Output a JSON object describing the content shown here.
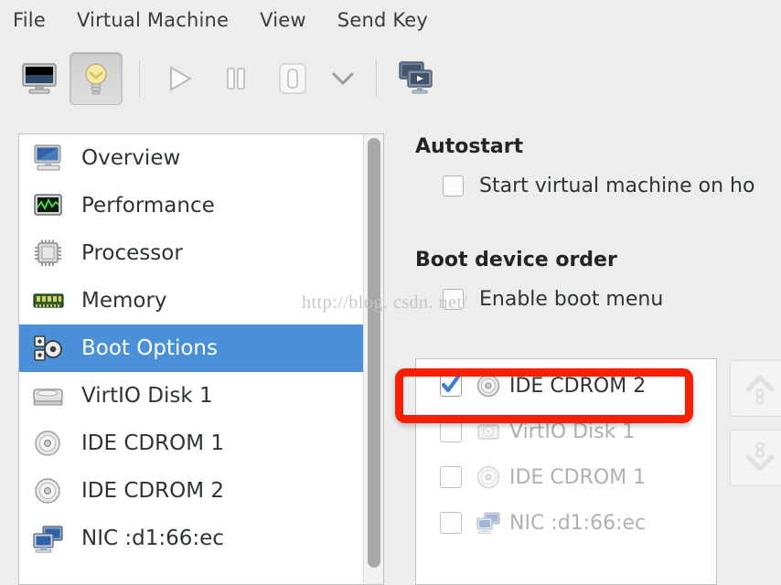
{
  "menubar": {
    "items": [
      {
        "label": "File",
        "name": "menu-file"
      },
      {
        "label": "Virtual Machine",
        "name": "menu-virtual-machine"
      },
      {
        "label": "View",
        "name": "menu-view"
      },
      {
        "label": "Send Key",
        "name": "menu-send-key"
      }
    ]
  },
  "toolbar": {
    "buttons": [
      {
        "icon": "monitor-console-icon",
        "pressed": false
      },
      {
        "icon": "lightbulb-details-icon",
        "pressed": true
      },
      {
        "icon": "play-run-icon",
        "pressed": false
      },
      {
        "icon": "pause-icon",
        "pressed": false
      },
      {
        "icon": "shutdown-icon",
        "pressed": false
      },
      {
        "icon": "chevron-down-icon",
        "pressed": false
      },
      {
        "icon": "snapshot-clone-icon",
        "pressed": false
      }
    ]
  },
  "hardware_list": {
    "items": [
      {
        "label": "Overview",
        "icon": "computer-icon",
        "selected": false
      },
      {
        "label": "Performance",
        "icon": "graph-monitor-icon",
        "selected": false
      },
      {
        "label": "Processor",
        "icon": "cpu-chip-icon",
        "selected": false
      },
      {
        "label": "Memory",
        "icon": "memory-ram-icon",
        "selected": false
      },
      {
        "label": "Boot Options",
        "icon": "boot-gears-icon",
        "selected": true
      },
      {
        "label": "VirtIO Disk 1",
        "icon": "harddisk-icon",
        "selected": false
      },
      {
        "label": "IDE CDROM 1",
        "icon": "cdrom-disc-icon",
        "selected": false
      },
      {
        "label": "IDE CDROM 2",
        "icon": "cdrom-disc-icon",
        "selected": false
      },
      {
        "label": "NIC :d1:66:ec",
        "icon": "network-card-icon",
        "selected": false
      }
    ]
  },
  "details": {
    "autostart": {
      "title": "Autostart",
      "checkbox_label": "Start virtual machine on ho",
      "checked": false
    },
    "boot_order": {
      "title": "Boot device order",
      "enable_boot_menu_label": "Enable boot menu",
      "enable_boot_menu_checked": false,
      "devices": [
        {
          "label": "IDE CDROM 2",
          "icon": "cdrom-disc-icon",
          "checked": true,
          "enabled": true
        },
        {
          "label": "VirtIO Disk 1",
          "icon": "harddisk-icon",
          "checked": false,
          "enabled": false
        },
        {
          "label": "IDE CDROM 1",
          "icon": "cdrom-disc-icon",
          "checked": false,
          "enabled": false
        },
        {
          "label": "NIC :d1:66:ec",
          "icon": "network-card-icon",
          "checked": false,
          "enabled": false
        }
      ],
      "move_up_icon": "move-up-icon",
      "move_down_icon": "move-down-icon"
    }
  },
  "annotation": {
    "color": "#f62000",
    "target": "IDE CDROM 2"
  },
  "watermark": {
    "text": "http://blog. csdn. net/"
  },
  "colors": {
    "window_background": "#ededed",
    "selection_blue": "#4a90d9",
    "list_background": "#ffffff",
    "text": "#2e3436",
    "disabled_text": "#b0b0b0"
  }
}
